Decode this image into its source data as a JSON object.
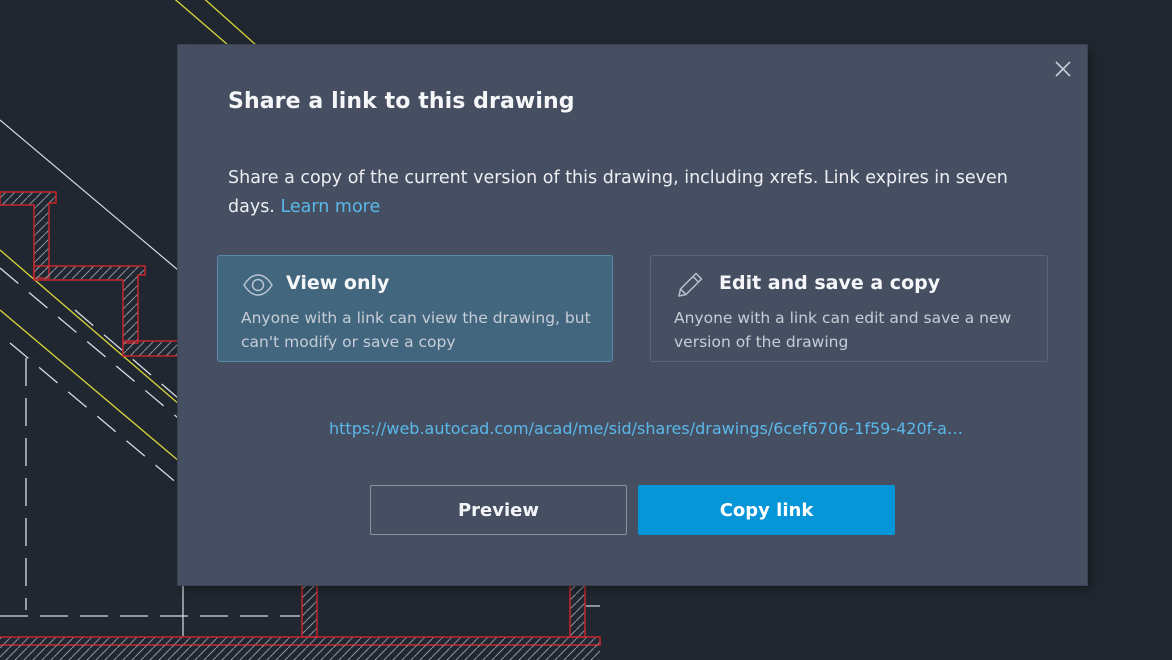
{
  "dialog": {
    "title": "Share a link to this drawing",
    "description": "Share a copy of the current version of this drawing, including xrefs. Link expires in seven days.",
    "learn_more_label": "Learn more",
    "close_icon": "close-icon",
    "options": [
      {
        "icon": "eye-icon",
        "title": "View only",
        "description": "Anyone with a link can view the drawing, but can't modify or save a copy",
        "selected": true
      },
      {
        "icon": "pencil-icon",
        "title": "Edit and save a copy",
        "description": "Anyone with a link can edit and save a new version of the drawing",
        "selected": false
      }
    ],
    "share_url": "https://web.autocad.com/acad/me/sid/shares/drawings/6cef6706-1f59-420f-a…",
    "buttons": {
      "preview_label": "Preview",
      "copy_link_label": "Copy link"
    }
  },
  "colors": {
    "backdrop": "#212730",
    "dialog_bg": "#464f62",
    "selected_option_bg": "#43667f",
    "link": "#5ab8ea",
    "primary_button": "#0696d7",
    "cad_red": "#c4262e",
    "cad_yellow": "#d6d63a",
    "cad_white": "#d8dce2"
  }
}
